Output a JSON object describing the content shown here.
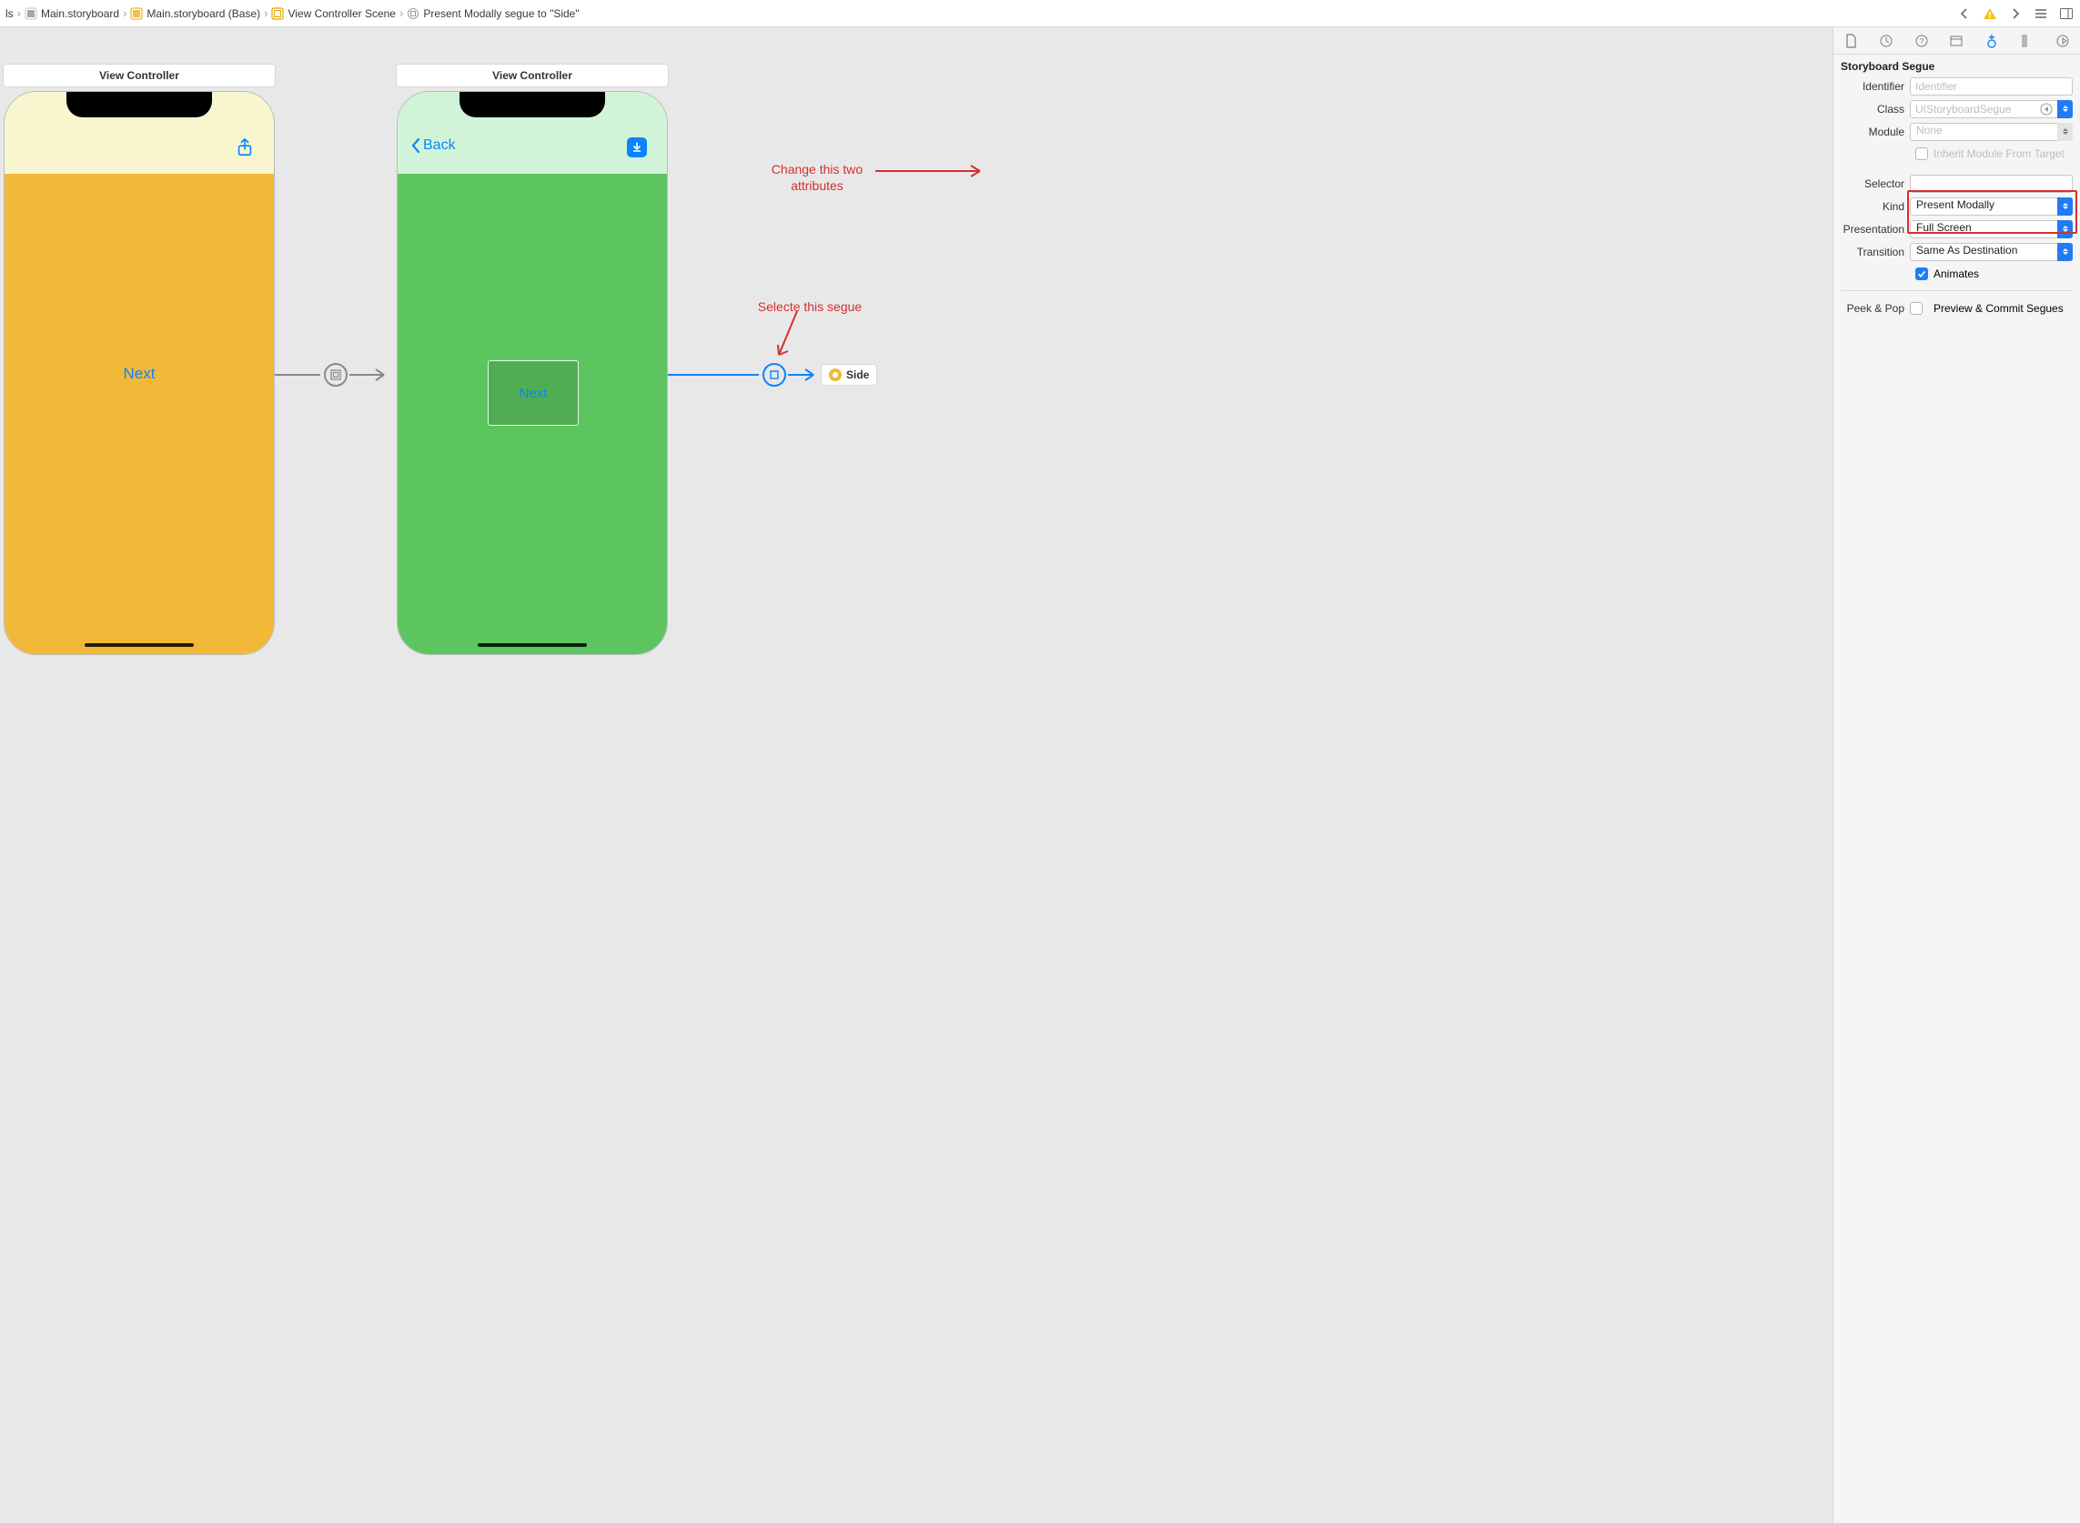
{
  "breadcrumbs": {
    "item0_suffix": "ls",
    "item1": "Main.storyboard",
    "item2": "Main.storyboard (Base)",
    "item3": "View Controller Scene",
    "item4": "Present Modally segue to \"Side\""
  },
  "canvas": {
    "scene1_title": "View Controller",
    "scene2_title": "View Controller",
    "phone1_next": "Next",
    "phone2_back": "Back",
    "phone2_next": "Next",
    "side_badge": "Side"
  },
  "annotations": {
    "change_line1": "Change this two",
    "change_line2": "attributes",
    "select_segue": "Selecte this segue"
  },
  "inspector": {
    "section_title": "Storyboard Segue",
    "labels": {
      "identifier": "Identifier",
      "class": "Class",
      "module": "Module",
      "inherit": "Inherit Module From Target",
      "selector": "Selector",
      "kind": "Kind",
      "presentation": "Presentation",
      "transition": "Transition",
      "animates": "Animates",
      "peek": "Peek & Pop",
      "preview": "Preview & Commit Segues"
    },
    "values": {
      "identifier_placeholder": "Identifier",
      "class_placeholder": "UIStoryboardSegue",
      "module_value": "None",
      "selector_value": "",
      "kind_value": "Present Modally",
      "presentation_value": "Full Screen",
      "transition_value": "Same As Destination"
    }
  }
}
